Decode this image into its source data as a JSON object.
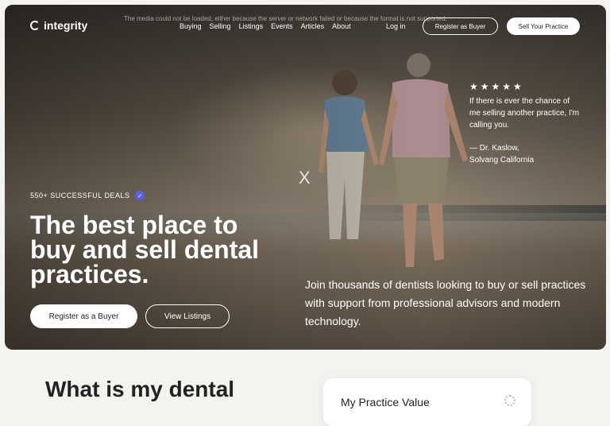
{
  "brand": {
    "name": "integrity"
  },
  "media_error": "The media could not be loaded, either because the server or network failed or because the format is not supported.",
  "nav": {
    "links": [
      "Buying",
      "Selling",
      "Listings",
      "Events",
      "Articles",
      "About"
    ],
    "login": "Log in",
    "register_buyer": "Register as Buyer",
    "sell_practice": "Sell Your Practice"
  },
  "video": {
    "close_glyph": "X"
  },
  "testimonial": {
    "stars": "★★★★★",
    "text": "If there is ever the chance of me selling another practice, I'm calling you.",
    "author": "— Dr. Kaslow,",
    "location": "Solvang California"
  },
  "hero": {
    "deals": "550+ SUCCESSFUL DEALS",
    "verified_glyph": "✓",
    "headline": "The best place to buy and sell dental practices.",
    "subtext": "Join thousands of dentists looking to buy or sell practices with support from professional advisors and modern technology.",
    "register_button": "Register as a Buyer",
    "view_button": "View Listings"
  },
  "section": {
    "title": "What is my dental",
    "card_title": "My Practice Value"
  },
  "colors": {
    "accent": "#5b5fe0",
    "background": "#f4f3f0"
  }
}
